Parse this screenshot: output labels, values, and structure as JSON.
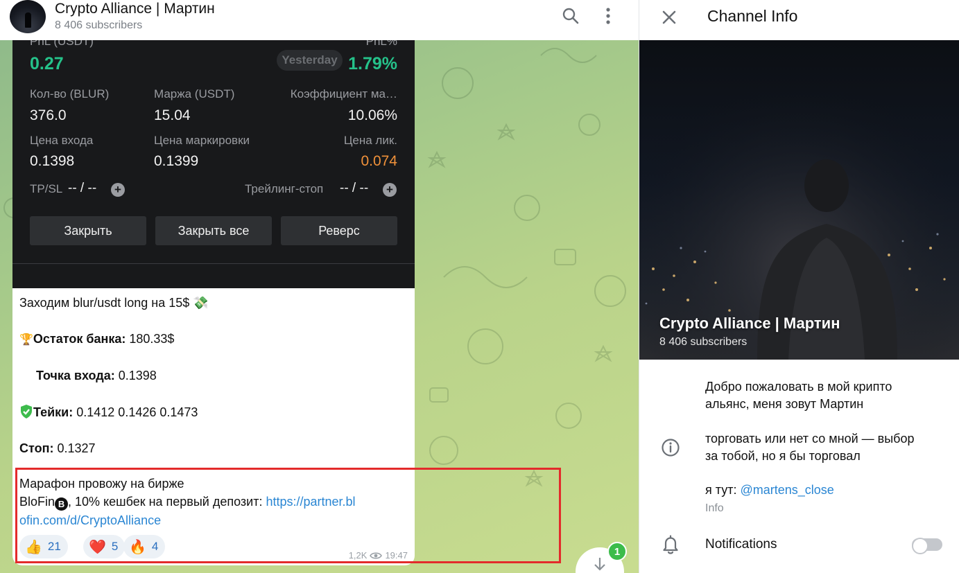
{
  "chat_header": {
    "title": "Crypto Alliance | Мартин",
    "subtitle": "8 406 subscribers"
  },
  "trade_card": {
    "pnl_label": "PnL (USDT)",
    "pnl_value": "0.27",
    "pnl_pct_label": "PnL%",
    "pnl_pct_value": "1.79%",
    "yesterday_badge": "Yesterday",
    "qty_label": "Кол-во (BLUR)",
    "qty_value": "376.0",
    "margin_label": "Маржа (USDT)",
    "margin_value": "15.04",
    "ratio_label": "Коэффициент ма…",
    "ratio_value": "10.06%",
    "entry_label": "Цена входа",
    "entry_value": "0.1398",
    "mark_label": "Цена маркировки",
    "mark_value": "0.1399",
    "liq_label": "Цена лик.",
    "liq_value": "0.074",
    "tpsl_label": "TP/SL",
    "tpsl_value": "-- / --",
    "trailing_label": "Трейлинг-стоп",
    "trailing_value": "-- / --",
    "buttons": {
      "close": "Закрыть",
      "close_all": "Закрыть все",
      "reverse": "Реверс"
    }
  },
  "message": {
    "line1": "Заходим blur/usdt long на 15$",
    "bank_label": "Остаток банка:",
    "bank_value": " 180.33$",
    "entry_label": "Точка входа:",
    "entry_value": " 0.1398",
    "takes_label": "Тейки:",
    "takes_value": " 0.1412 0.1426 0.1473",
    "stop_label": "Стоп:",
    "stop_value": " 0.1327",
    "marathon_line1": "Марафон провожу на бирже",
    "marathon_line2_prefix": "BloFin",
    "marathon_line2_suffix": ", 10% кешбек на первый депозит:  ",
    "link_part1": "https://partner.bl",
    "link_part2": "ofin.com/d/CryptoAlliance",
    "reactions": [
      {
        "emoji": "👍",
        "count": "21"
      },
      {
        "emoji": "❤️",
        "count": "5"
      },
      {
        "emoji": "🔥",
        "count": "4"
      }
    ],
    "views": "1,2K",
    "time": "19:47"
  },
  "unread_count": "1",
  "info_panel": {
    "title": "Channel Info",
    "channel_name": "Crypto Alliance | Мартин",
    "subscribers": "8 406 subscribers",
    "desc_line1": "Добро пожаловать в мой крипто",
    "desc_line2": "альянс, меня зовут Мартин",
    "desc_line3": "торговать или нет со мной — выбор",
    "desc_line4": "за тобой, но я бы торговал",
    "contact_prefix": "я тут: ",
    "contact_handle": "@martens_close",
    "info_hint": "Info",
    "notifications_label": "Notifications"
  },
  "colors": {
    "accent_link": "#2a86d3",
    "pnl_green": "#25c28a",
    "liq_orange": "#f0913a",
    "highlight_red": "#e32b2b",
    "badge_green": "#3cbc4a"
  }
}
